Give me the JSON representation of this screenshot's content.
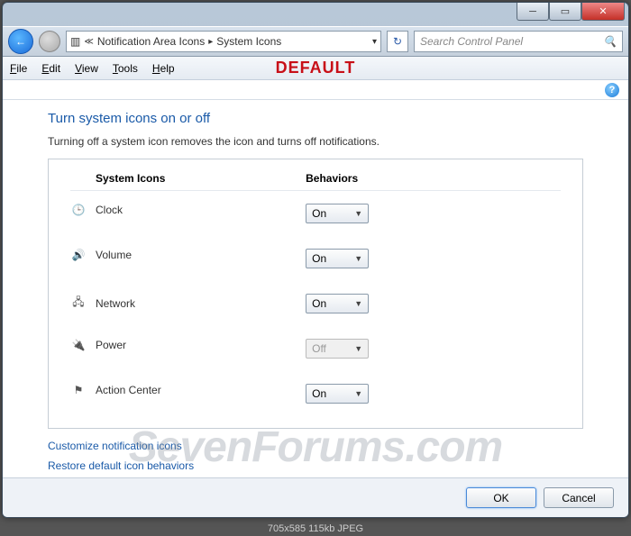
{
  "breadcrumb": {
    "parent": "Notification Area Icons",
    "current": "System Icons"
  },
  "search": {
    "placeholder": "Search Control Panel"
  },
  "menu": {
    "file": "File",
    "edit": "Edit",
    "view": "View",
    "tools": "Tools",
    "help": "Help"
  },
  "overlay": {
    "default_label": "DEFAULT"
  },
  "page": {
    "title": "Turn system icons on or off",
    "description": "Turning off a system icon removes the icon and turns off notifications."
  },
  "table": {
    "col_icons": "System Icons",
    "col_behaviors": "Behaviors"
  },
  "rows": [
    {
      "icon": "clock-icon",
      "glyph": "🕒",
      "name": "Clock",
      "value": "On",
      "enabled": true
    },
    {
      "icon": "volume-icon",
      "glyph": "🔊",
      "name": "Volume",
      "value": "On",
      "enabled": true
    },
    {
      "icon": "network-icon",
      "glyph": "🖧",
      "name": "Network",
      "value": "On",
      "enabled": true
    },
    {
      "icon": "power-icon",
      "glyph": "🔌",
      "name": "Power",
      "value": "Off",
      "enabled": false
    },
    {
      "icon": "action-center-icon",
      "glyph": "⚑",
      "name": "Action Center",
      "value": "On",
      "enabled": true
    }
  ],
  "links": {
    "customize": "Customize notification icons",
    "restore": "Restore default icon behaviors"
  },
  "buttons": {
    "ok": "OK",
    "cancel": "Cancel"
  },
  "watermark": "SevenForums.com",
  "footer": "705x585   115kb   JPEG"
}
